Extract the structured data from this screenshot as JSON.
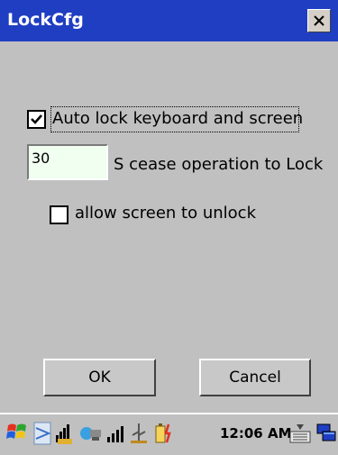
{
  "window": {
    "title": "LockCfg",
    "close_label": "✕"
  },
  "options": {
    "auto_lock_label": "Auto lock keyboard and screen",
    "auto_lock_checked": true,
    "timeout_value": "30",
    "timeout_suffix": "S cease operation to Lock",
    "allow_unlock_label": "allow screen to unlock",
    "allow_unlock_checked": false
  },
  "buttons": {
    "ok": "OK",
    "cancel": "Cancel"
  },
  "taskbar": {
    "clock": "12:06 AM",
    "icons": [
      "start-flag-icon",
      "connection-icon",
      "signal-icon",
      "network-icon",
      "signal-bars-icon",
      "usb-icon",
      "battery-icon",
      "keyboard-icon",
      "desktop-icon"
    ]
  },
  "colors": {
    "titlebar": "#1f3ec1",
    "background": "#c0c0c0",
    "edit_background": "#f0fff0"
  }
}
